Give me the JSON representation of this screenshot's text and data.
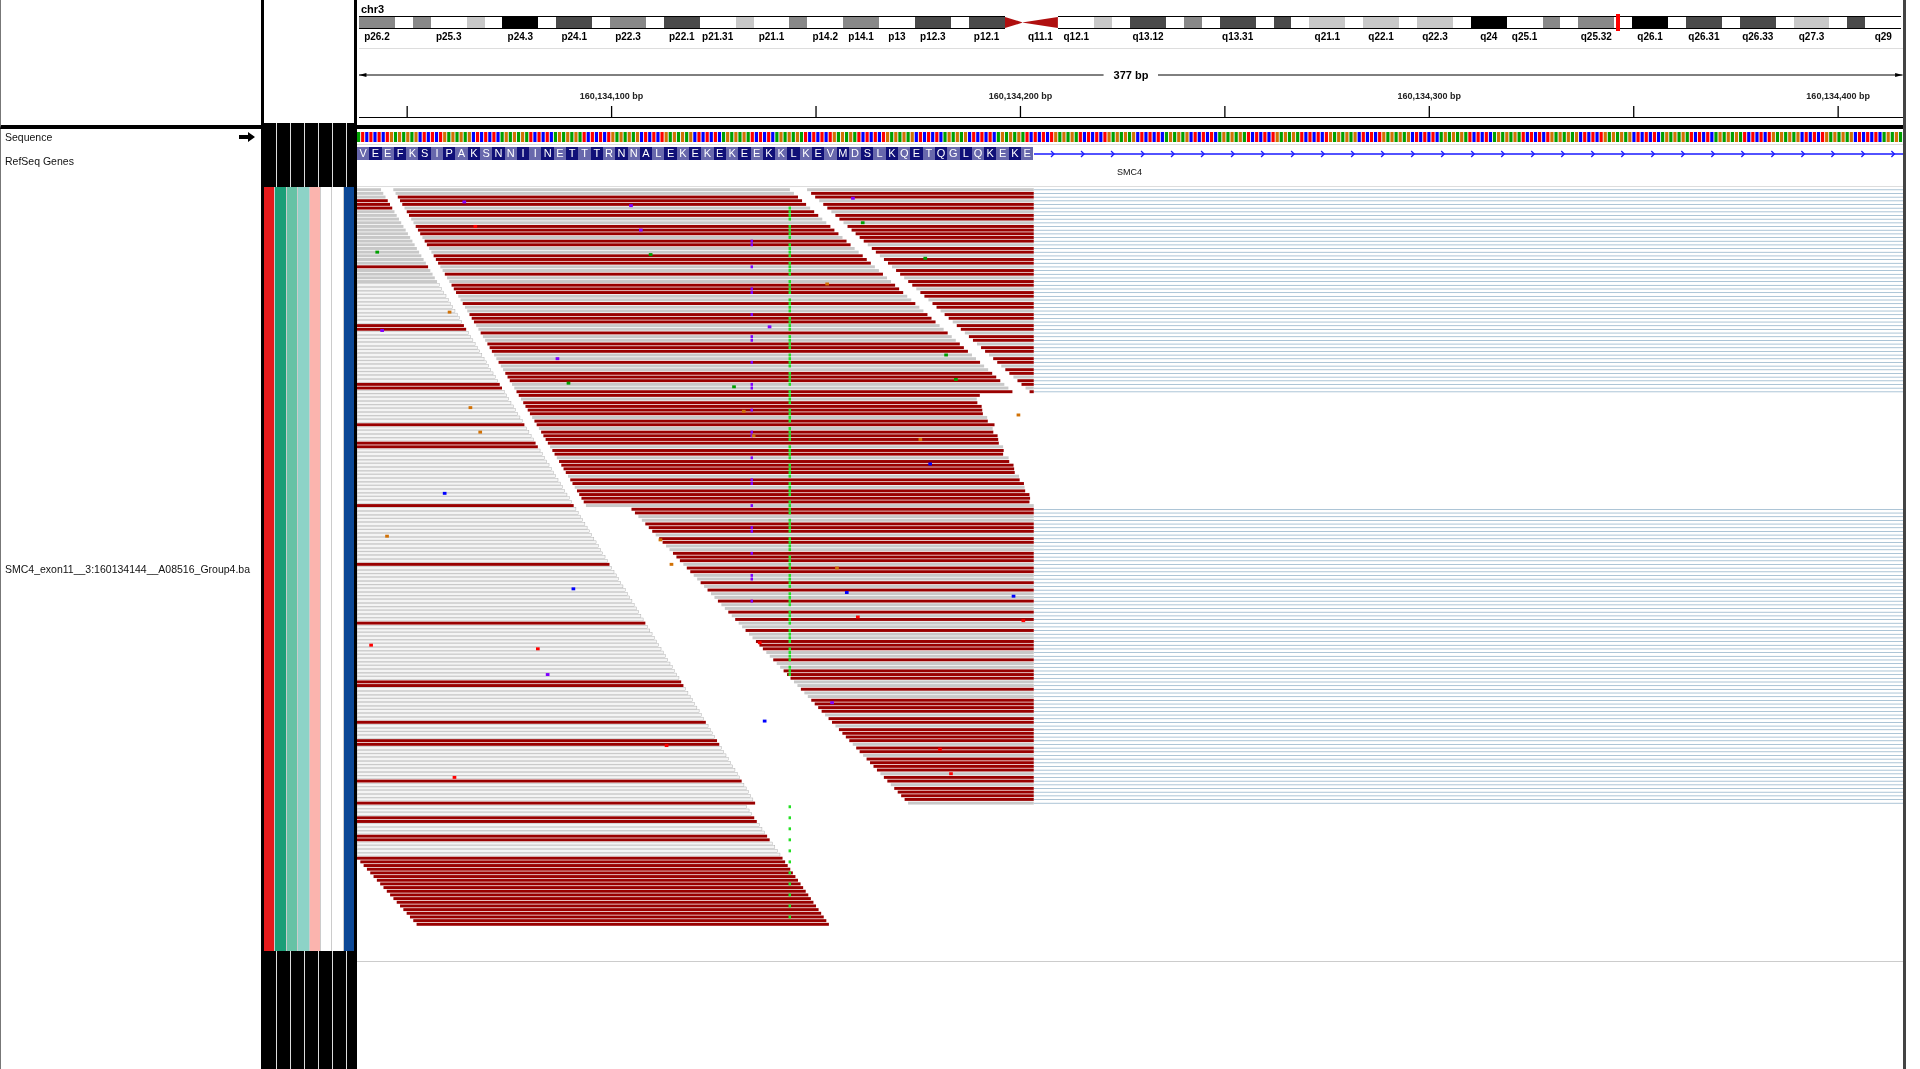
{
  "ideogram": {
    "chromosome": "chr3",
    "bands": [
      {
        "kind": "gpos50",
        "label": "p26.2",
        "current": false
      },
      {
        "kind": "gneg",
        "current": false
      },
      {
        "kind": "gpos50",
        "current": false
      },
      {
        "kind": "gneg",
        "label": "p25.3",
        "current": false
      },
      {
        "kind": "gpos25",
        "current": false
      },
      {
        "kind": "gneg",
        "current": false
      },
      {
        "kind": "gpos100",
        "label": "p24.3",
        "current": false
      },
      {
        "kind": "gneg",
        "current": false
      },
      {
        "kind": "gpos75",
        "label": "p24.1",
        "current": false
      },
      {
        "kind": "gneg",
        "current": false
      },
      {
        "kind": "gpos50",
        "label": "p22.3",
        "current": false
      },
      {
        "kind": "gneg",
        "current": false
      },
      {
        "kind": "gpos75",
        "label": "p22.1",
        "current": false
      },
      {
        "kind": "gneg",
        "label": "p21.31",
        "current": false
      },
      {
        "kind": "gpos25",
        "current": false
      },
      {
        "kind": "gneg",
        "label": "p21.1",
        "current": false
      },
      {
        "kind": "gpos50",
        "current": false
      },
      {
        "kind": "gneg",
        "label": "p14.2",
        "current": false
      },
      {
        "kind": "gpos50",
        "label": "p14.1",
        "current": false
      },
      {
        "kind": "gneg",
        "label": "p13",
        "current": false
      },
      {
        "kind": "gpos75",
        "label": "p12.3",
        "current": false
      },
      {
        "kind": "gneg",
        "current": false
      },
      {
        "kind": "gpos75",
        "label": "p12.1",
        "current": false
      },
      {
        "kind": "acen",
        "current": false
      },
      {
        "kind": "acen",
        "label": "q11.1",
        "current": false
      },
      {
        "kind": "gneg",
        "label": "q12.1",
        "current": false
      },
      {
        "kind": "gpos25",
        "current": false
      },
      {
        "kind": "gneg",
        "current": false
      },
      {
        "kind": "gpos75",
        "label": "q13.12",
        "current": false
      },
      {
        "kind": "gneg",
        "current": false
      },
      {
        "kind": "gpos50",
        "current": false
      },
      {
        "kind": "gneg",
        "current": false
      },
      {
        "kind": "gpos75",
        "label": "q13.31",
        "current": false
      },
      {
        "kind": "gneg",
        "current": false
      },
      {
        "kind": "gpos75",
        "current": false
      },
      {
        "kind": "gneg",
        "current": false
      },
      {
        "kind": "gpos25",
        "label": "q21.1",
        "current": false
      },
      {
        "kind": "gneg",
        "current": false
      },
      {
        "kind": "gpos25",
        "label": "q22.1",
        "current": false
      },
      {
        "kind": "gneg",
        "current": false
      },
      {
        "kind": "gpos25",
        "label": "q22.3",
        "current": false
      },
      {
        "kind": "gneg",
        "current": false
      },
      {
        "kind": "gpos100",
        "label": "q24",
        "current": false
      },
      {
        "kind": "gneg",
        "label": "q25.1",
        "current": false
      },
      {
        "kind": "gpos50",
        "current": false
      },
      {
        "kind": "gneg",
        "current": false
      },
      {
        "kind": "gpos50",
        "label": "q25.32",
        "current": false
      },
      {
        "kind": "gneg",
        "current": true
      },
      {
        "kind": "gpos100",
        "label": "q26.1",
        "current": false
      },
      {
        "kind": "gneg",
        "current": false
      },
      {
        "kind": "gpos75",
        "label": "q26.31",
        "current": false
      },
      {
        "kind": "gneg",
        "current": false
      },
      {
        "kind": "gpos75",
        "label": "q26.33",
        "current": false
      },
      {
        "kind": "gneg",
        "current": false
      },
      {
        "kind": "gpos25",
        "label": "q27.3",
        "current": false
      },
      {
        "kind": "gneg",
        "current": false
      },
      {
        "kind": "gpos75",
        "current": false
      },
      {
        "kind": "gneg",
        "label": "q29",
        "current": false
      }
    ]
  },
  "ruler": {
    "span": "377 bp",
    "ticks": [
      "160,134,100 bp",
      "160,134,200 bp",
      "160,134,300 bp",
      "160,134,400 bp"
    ]
  },
  "tracks": [
    {
      "kind": "sequence",
      "name": "Sequence"
    },
    {
      "kind": "gene",
      "name": "RefSeq Genes",
      "gene": "SMC4",
      "amino_acids": [
        "V",
        "E",
        "E",
        "F",
        "K",
        "S",
        "I",
        "P",
        "A",
        "K",
        "S",
        "N",
        "N",
        "I",
        "I",
        "N",
        "E",
        "T",
        "T",
        "T",
        "R",
        "N",
        "N",
        "A",
        "L",
        "E",
        "K",
        "E",
        "K",
        "E",
        "K",
        "E",
        "E",
        "K",
        "K",
        "L",
        "K",
        "E",
        "V",
        "M",
        "D",
        "S",
        "L",
        "K",
        "Q",
        "E",
        "T",
        "Q",
        "G",
        "L",
        "Q",
        "K",
        "E",
        "K",
        "E"
      ]
    },
    {
      "kind": "alignment",
      "name": "SMC4_exon11__3:160134144__A08516_Group4.ba",
      "attributes": [
        {
          "color": "#e41a1c"
        },
        {
          "color": "#1b9e77"
        },
        {
          "color": "#66c2a5"
        },
        {
          "color": "#8dd3c7"
        },
        {
          "color": "#fbb4ae"
        },
        {
          "color": "#ffffff"
        },
        {
          "color": "#ffffff"
        },
        {
          "color": "#0c4896"
        }
      ]
    }
  ]
}
